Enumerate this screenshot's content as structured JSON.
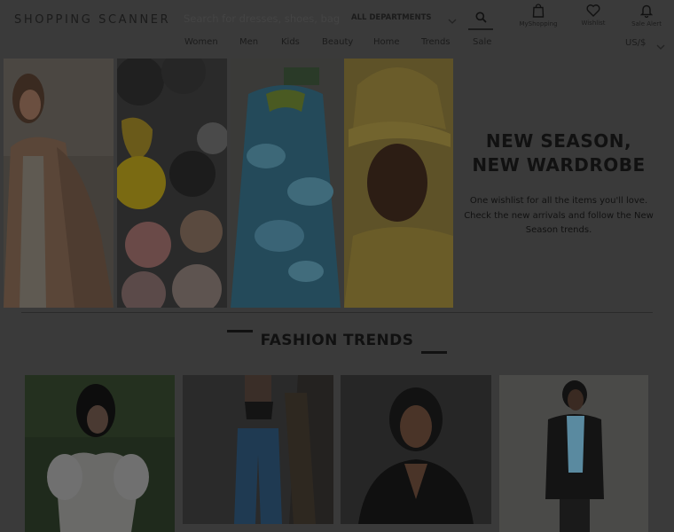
{
  "header": {
    "logo": "SHOPPING SCANNER",
    "search_placeholder": "Search for dresses, shoes, bag",
    "department": "ALL DEPARTMENTS",
    "tools": {
      "myshopping": "MyShopping",
      "wishlist": "Wishlist",
      "sale_alert": "Sale Alert"
    },
    "currency": "US/$"
  },
  "nav": [
    "Women",
    "Men",
    "Kids",
    "Beauty",
    "Home",
    "Trends",
    "Sale"
  ],
  "hero": {
    "title_line1": "NEW SEASON,",
    "title_line2": "NEW WARDROBE",
    "text": "One wishlist for all the items you'll love. Check the new arrivals and follow the New Season trends."
  },
  "section": {
    "title": "FASHION TRENDS"
  }
}
